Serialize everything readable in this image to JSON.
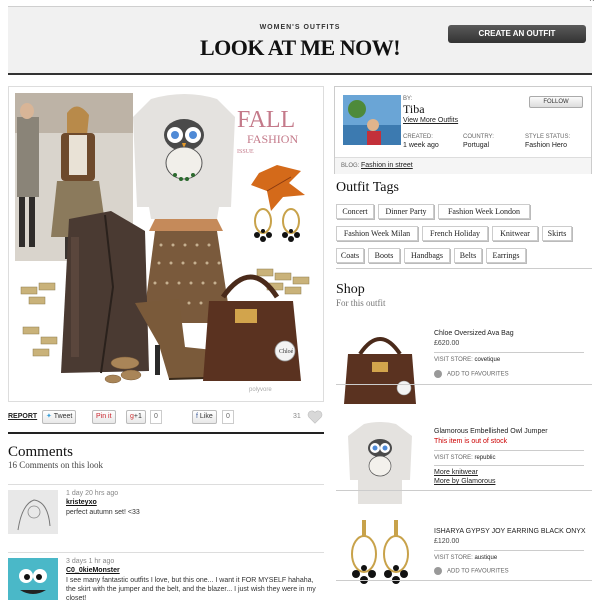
{
  "header": {
    "kicker": "WOMEN'S OUTFITS",
    "title": "LOOK AT ME NOW!",
    "create_button": "CREATE AN OUTFIT",
    "caret": "^"
  },
  "outfit_image": {
    "fall_word": "FALL",
    "fashion_word": "FASHION",
    "issue_word": "ISSUE",
    "bag_tag": "Chloé",
    "watermark": "polyvore"
  },
  "share": {
    "report": "REPORT",
    "tweet": "Tweet",
    "pinit": "Pin it",
    "gplus": "+1",
    "gplus_count": "0",
    "like": "Like",
    "like_count": "0",
    "likes_total": "31"
  },
  "creator": {
    "by_label": "BY:",
    "name": "Tiba",
    "more_link": "View More Outfits",
    "follow": "FOLLOW",
    "created_label": "CREATED:",
    "created_value": "1 week ago",
    "country_label": "COUNTRY:",
    "country_value": "Portugal",
    "style_label": "STYLE STATUS:",
    "style_value": "Fashion Hero",
    "blog_label": "BLOG:",
    "blog_value": "Fashion in street"
  },
  "tags": {
    "title": "Outfit Tags",
    "items": [
      "Concert",
      "Dinner Party",
      "Fashion Week London",
      "Fashion Week Milan",
      "French Holiday",
      "Knitwear",
      "Skirts",
      "Coats",
      "Boots",
      "Handbags",
      "Belts",
      "Earrings"
    ]
  },
  "shop": {
    "title": "Shop",
    "subtitle": "For this outfit",
    "items": [
      {
        "name": "Chloe Oversized Ava Bag",
        "price": "£620.00",
        "store_label": "VISIT STORE:",
        "store": "covetique",
        "fav": "ADD TO FAVOURITES"
      },
      {
        "name": "Glamorous Embellished Owl Jumper",
        "stock": "This item is out of stock",
        "store_label": "VISIT STORE:",
        "store": "republic",
        "link1": "More knitwear",
        "link2": "More by Glamorous"
      },
      {
        "name": "ISHARYA GYPSY JOY EARRING BLACK ONYX",
        "price": "£120.00",
        "store_label": "VISIT STORE:",
        "store": "austique",
        "fav": "ADD TO FAVOURITES"
      }
    ]
  },
  "comments": {
    "title": "Comments",
    "count": "16 Comments on this look",
    "items": [
      {
        "time": "1 day 20 hrs ago",
        "user": "kristeyxo",
        "text": "perfect autumn set! <33"
      },
      {
        "time": "3 days 1 hr ago",
        "user": "C0_0kieMonster",
        "text": "I see many fantastic outfits I love, but this one... I want it FOR MYSELF hahaha, the skirt with the jumper and the belt, and the blazer... I just wish they were in my closet!"
      }
    ]
  },
  "colors": {
    "header_bg": "#f1f1f1",
    "button_dark": "#333333",
    "out_of_stock": "#cc0000"
  }
}
